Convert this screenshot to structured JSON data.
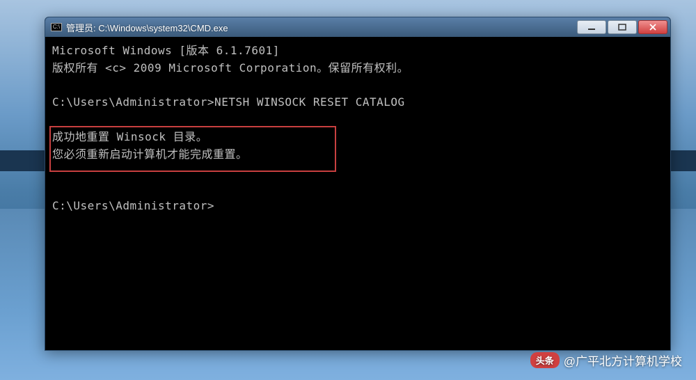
{
  "window": {
    "title": "管理员: C:\\Windows\\system32\\CMD.exe"
  },
  "terminal": {
    "lines": {
      "l1": "Microsoft Windows [版本 6.1.7601]",
      "l2": "版权所有 <c> 2009 Microsoft Corporation。保留所有权利。",
      "l3": "",
      "l4": "C:\\Users\\Administrator>NETSH WINSOCK RESET CATALOG",
      "l5": "",
      "l6": "成功地重置 Winsock 目录。",
      "l7": "您必须重新启动计算机才能完成重置。",
      "l8": "",
      "l9": "",
      "l10": "C:\\Users\\Administrator>"
    }
  },
  "watermark": {
    "badge": "头条",
    "handle": "@广平北方计算机学校"
  }
}
